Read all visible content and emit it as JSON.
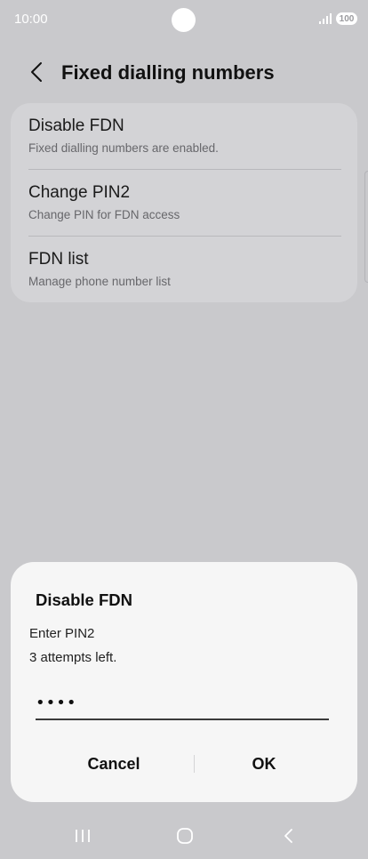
{
  "status_bar": {
    "time": "10:00",
    "battery": "100"
  },
  "header": {
    "title": "Fixed dialling numbers"
  },
  "settings": {
    "items": [
      {
        "title": "Disable FDN",
        "subtitle": "Fixed dialling numbers are enabled."
      },
      {
        "title": "Change PIN2",
        "subtitle": "Change PIN for FDN access"
      },
      {
        "title": "FDN list",
        "subtitle": "Manage phone number list"
      }
    ]
  },
  "dialog": {
    "title": "Disable FDN",
    "message_line1": "Enter PIN2",
    "message_line2": "3 attempts left.",
    "pin_value": "••••",
    "cancel_label": "Cancel",
    "ok_label": "OK"
  },
  "icons": {
    "back": "chevron-left-icon",
    "signal": "signal-icon",
    "recents": "recents-icon",
    "home": "home-icon",
    "nav_back": "back-icon"
  },
  "colors": {
    "screen_bg": "#c9c9cc",
    "card_bg": "#d3d3d6",
    "dialog_bg": "#f6f6f6"
  }
}
